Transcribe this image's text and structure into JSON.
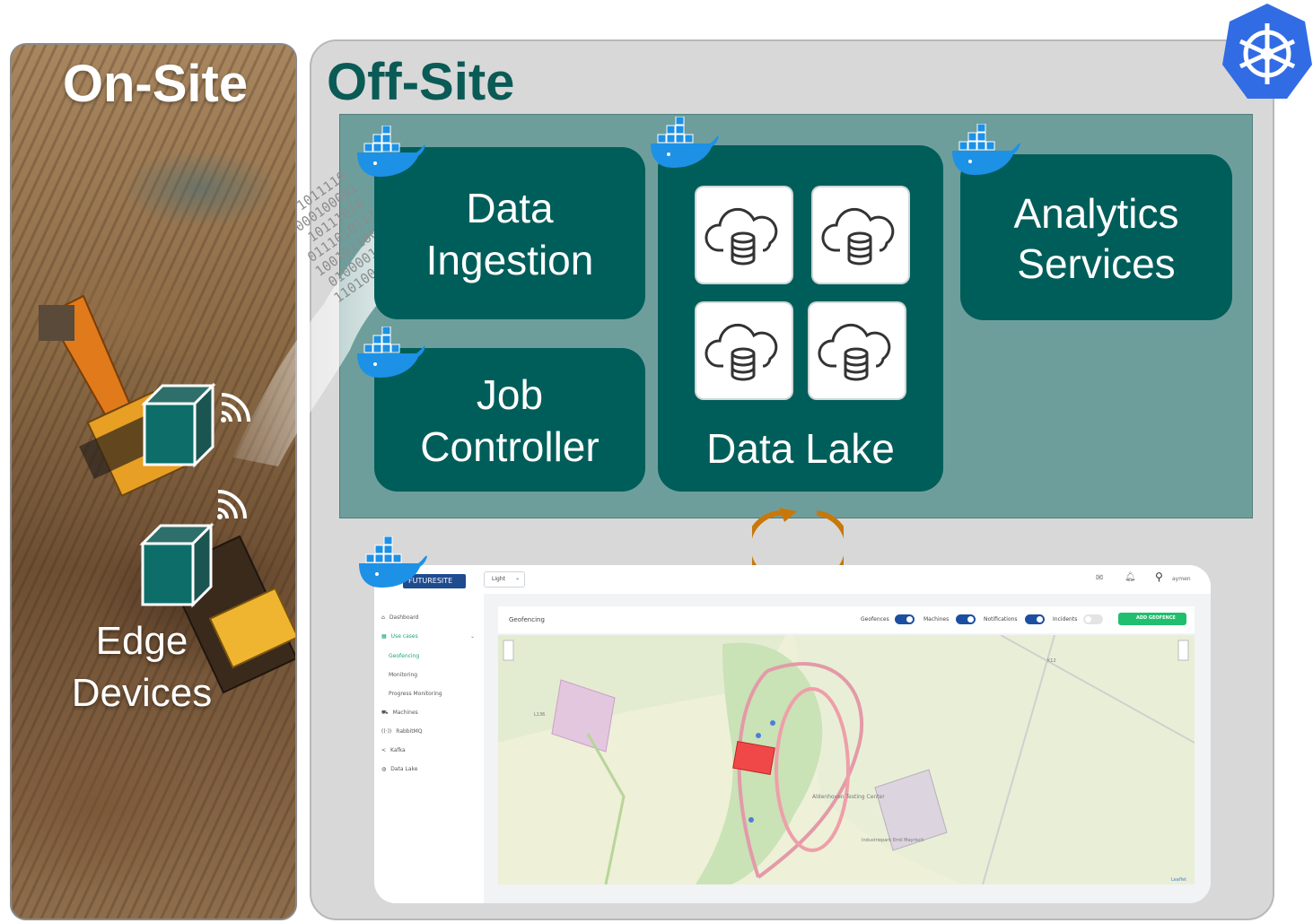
{
  "onsite": {
    "title": "On-Site",
    "edge_label_line1": "Edge",
    "edge_label_line2": "Devices"
  },
  "offsite": {
    "title": "Off-Site"
  },
  "services": {
    "ingestion_line1": "Data",
    "ingestion_line2": "Ingestion",
    "job_line1": "Job",
    "job_line2": "Controller",
    "lake": "Data Lake",
    "analytics_line1": "Analytics",
    "analytics_line2": "Services"
  },
  "binary_stream": [
    "1011110",
    "000100001",
    "10111010",
    "0111010111",
    "1001011000",
    "01000011",
    "1101000"
  ],
  "dashboard": {
    "brand": "FUTURESITE",
    "theme_select": "Light",
    "user": "aymen",
    "nav": [
      {
        "label": "Dashboard"
      },
      {
        "label": "Use cases"
      },
      {
        "label": "Geofencing"
      },
      {
        "label": "Monitoring"
      },
      {
        "label": "Progress Monitoring"
      },
      {
        "label": "Machines"
      },
      {
        "label": "RabbitMQ"
      },
      {
        "label": "Kafka"
      },
      {
        "label": "Data Lake"
      }
    ],
    "page_title": "Geofencing",
    "toggles": [
      {
        "label": "Geofences",
        "on": true
      },
      {
        "label": "Machines",
        "on": true
      },
      {
        "label": "Notifications",
        "on": true
      },
      {
        "label": "Incidents",
        "on": false
      }
    ],
    "add_button": "ADD GEOFENCE",
    "map_labels": {
      "testing_center": "Aldenhoven Testing Center",
      "industrial": "Industriepark Emil Mayrisch",
      "road1": "K12",
      "road2": "L136",
      "attribution": "Leaflet"
    }
  },
  "colors": {
    "teal_dark": "#005e5a",
    "teal_area": "#6e9e9c",
    "title_teal": "#0a5a55",
    "docker_blue": "#1d91e6",
    "k8s_blue": "#326ce5",
    "sync_orange": "#c8780a"
  }
}
